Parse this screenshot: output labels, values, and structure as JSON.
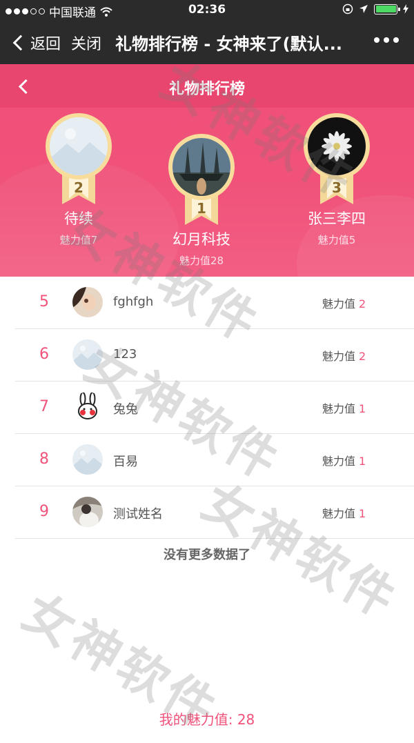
{
  "status_bar": {
    "carrier": "中国联通",
    "time": "02:36"
  },
  "nav_bar": {
    "back_label": "返回",
    "close_label": "关闭",
    "title": "礼物排行榜 - 女神来了(默认..."
  },
  "header": {
    "title": "礼物排行榜"
  },
  "podium": [
    {
      "rank": "2",
      "name": "待续",
      "charm": "魅力值7"
    },
    {
      "rank": "1",
      "name": "幻月科技",
      "charm": "魅力值28"
    },
    {
      "rank": "3",
      "name": "张三李四",
      "charm": "魅力值5"
    }
  ],
  "ranking_list": [
    {
      "rank": "5",
      "name": "fghfgh",
      "charm_label": "魅力值",
      "charm_value": "2",
      "avatar": "photo-girl-icon"
    },
    {
      "rank": "6",
      "name": "123",
      "charm_label": "魅力值",
      "charm_value": "2",
      "avatar": "default-mountain-icon"
    },
    {
      "rank": "7",
      "name": "兔兔",
      "charm_label": "魅力值",
      "charm_value": "1",
      "avatar": "rabbit-icon"
    },
    {
      "rank": "8",
      "name": "百易",
      "charm_label": "魅力值",
      "charm_value": "1",
      "avatar": "default-mountain-icon"
    },
    {
      "rank": "9",
      "name": "测试姓名",
      "charm_label": "魅力值",
      "charm_value": "1",
      "avatar": "photo-person-icon"
    }
  ],
  "no_more_text": "没有更多数据了",
  "my_charm": "我的魅力值: 28",
  "watermark": "女神软件",
  "colors": {
    "accent": "#f0527a",
    "navbar": "#2b2b2b",
    "medal_gold": "#f7dc9c"
  }
}
